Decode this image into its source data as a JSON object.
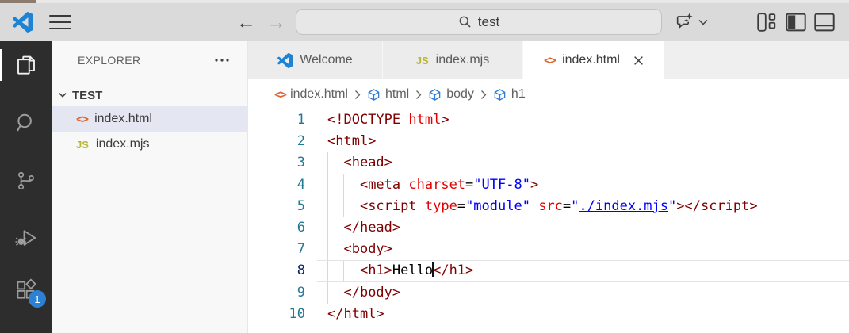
{
  "titlebar": {
    "search_text": "test"
  },
  "activity_bar": {
    "items": [
      {
        "name": "explorer",
        "active": true
      },
      {
        "name": "search",
        "active": false
      },
      {
        "name": "source-control",
        "active": false
      },
      {
        "name": "run-and-debug",
        "active": false
      },
      {
        "name": "extensions",
        "active": false,
        "badge": "1"
      }
    ],
    "badge": "1"
  },
  "explorer": {
    "title": "EXPLORER",
    "root_label": "TEST",
    "files": [
      {
        "name": "index.html",
        "icon": "html",
        "selected": true
      },
      {
        "name": "index.mjs",
        "icon": "js",
        "selected": false
      }
    ]
  },
  "tabs": [
    {
      "label": "Welcome",
      "icon": "vscode",
      "active": false,
      "closable": false
    },
    {
      "label": "index.mjs",
      "icon": "js",
      "active": false,
      "closable": false
    },
    {
      "label": "index.html",
      "icon": "html",
      "active": true,
      "closable": true
    }
  ],
  "breadcrumb": [
    {
      "label": "index.html",
      "icon": "html"
    },
    {
      "label": "html",
      "icon": "symbol"
    },
    {
      "label": "body",
      "icon": "symbol"
    },
    {
      "label": "h1",
      "icon": "symbol"
    }
  ],
  "editor": {
    "active_line": 8,
    "lines": [
      {
        "n": 1,
        "segments": [
          {
            "t": "<!DOCTYPE",
            "c": "tag"
          },
          {
            "t": " ",
            "c": "text"
          },
          {
            "t": "html",
            "c": "attr"
          },
          {
            "t": ">",
            "c": "tag"
          }
        ]
      },
      {
        "n": 2,
        "segments": [
          {
            "t": "<html>",
            "c": "tag"
          }
        ]
      },
      {
        "n": 3,
        "segments": [
          {
            "t": "  ",
            "c": "text"
          },
          {
            "t": "<head>",
            "c": "tag"
          }
        ]
      },
      {
        "n": 4,
        "segments": [
          {
            "t": "    ",
            "c": "text"
          },
          {
            "t": "<meta",
            "c": "tag"
          },
          {
            "t": " ",
            "c": "text"
          },
          {
            "t": "charset",
            "c": "attr"
          },
          {
            "t": "=",
            "c": "text"
          },
          {
            "t": "\"UTF-8\"",
            "c": "string"
          },
          {
            "t": ">",
            "c": "tag"
          }
        ]
      },
      {
        "n": 5,
        "segments": [
          {
            "t": "    ",
            "c": "text"
          },
          {
            "t": "<script",
            "c": "tag"
          },
          {
            "t": " ",
            "c": "text"
          },
          {
            "t": "type",
            "c": "attr"
          },
          {
            "t": "=",
            "c": "text"
          },
          {
            "t": "\"module\"",
            "c": "string"
          },
          {
            "t": " ",
            "c": "text"
          },
          {
            "t": "src",
            "c": "attr"
          },
          {
            "t": "=",
            "c": "text"
          },
          {
            "t": "\"",
            "c": "string"
          },
          {
            "t": "./index.mjs",
            "c": "string",
            "u": true
          },
          {
            "t": "\"",
            "c": "string"
          },
          {
            "t": ">",
            "c": "tag"
          },
          {
            "t": "</script>",
            "c": "tag"
          }
        ]
      },
      {
        "n": 6,
        "segments": [
          {
            "t": "  ",
            "c": "text"
          },
          {
            "t": "</head>",
            "c": "tag"
          }
        ]
      },
      {
        "n": 7,
        "segments": [
          {
            "t": "  ",
            "c": "text"
          },
          {
            "t": "<body>",
            "c": "tag"
          }
        ]
      },
      {
        "n": 8,
        "segments": [
          {
            "t": "    ",
            "c": "text"
          },
          {
            "t": "<h1>",
            "c": "tag"
          },
          {
            "t": "Hello",
            "c": "text"
          },
          {
            "cursor": true
          },
          {
            "t": "</h1>",
            "c": "tag"
          }
        ]
      },
      {
        "n": 9,
        "segments": [
          {
            "t": "  ",
            "c": "text"
          },
          {
            "t": "</body>",
            "c": "tag"
          }
        ]
      },
      {
        "n": 10,
        "segments": [
          {
            "t": "</html>",
            "c": "tag"
          }
        ]
      }
    ]
  },
  "colors": {
    "accent_blue": "#1d83d4",
    "activity_badge": "#2b82d4",
    "html_icon": "#e0632e",
    "js_icon": "#b7b73b",
    "breadcrumb_symbol": "#2b7cd6",
    "line_number": "#237893",
    "line_number_active": "#0b216f",
    "syntax": {
      "tag": "#800000",
      "attr": "#e50000",
      "string": "#0000ff",
      "text": "#000000"
    }
  }
}
